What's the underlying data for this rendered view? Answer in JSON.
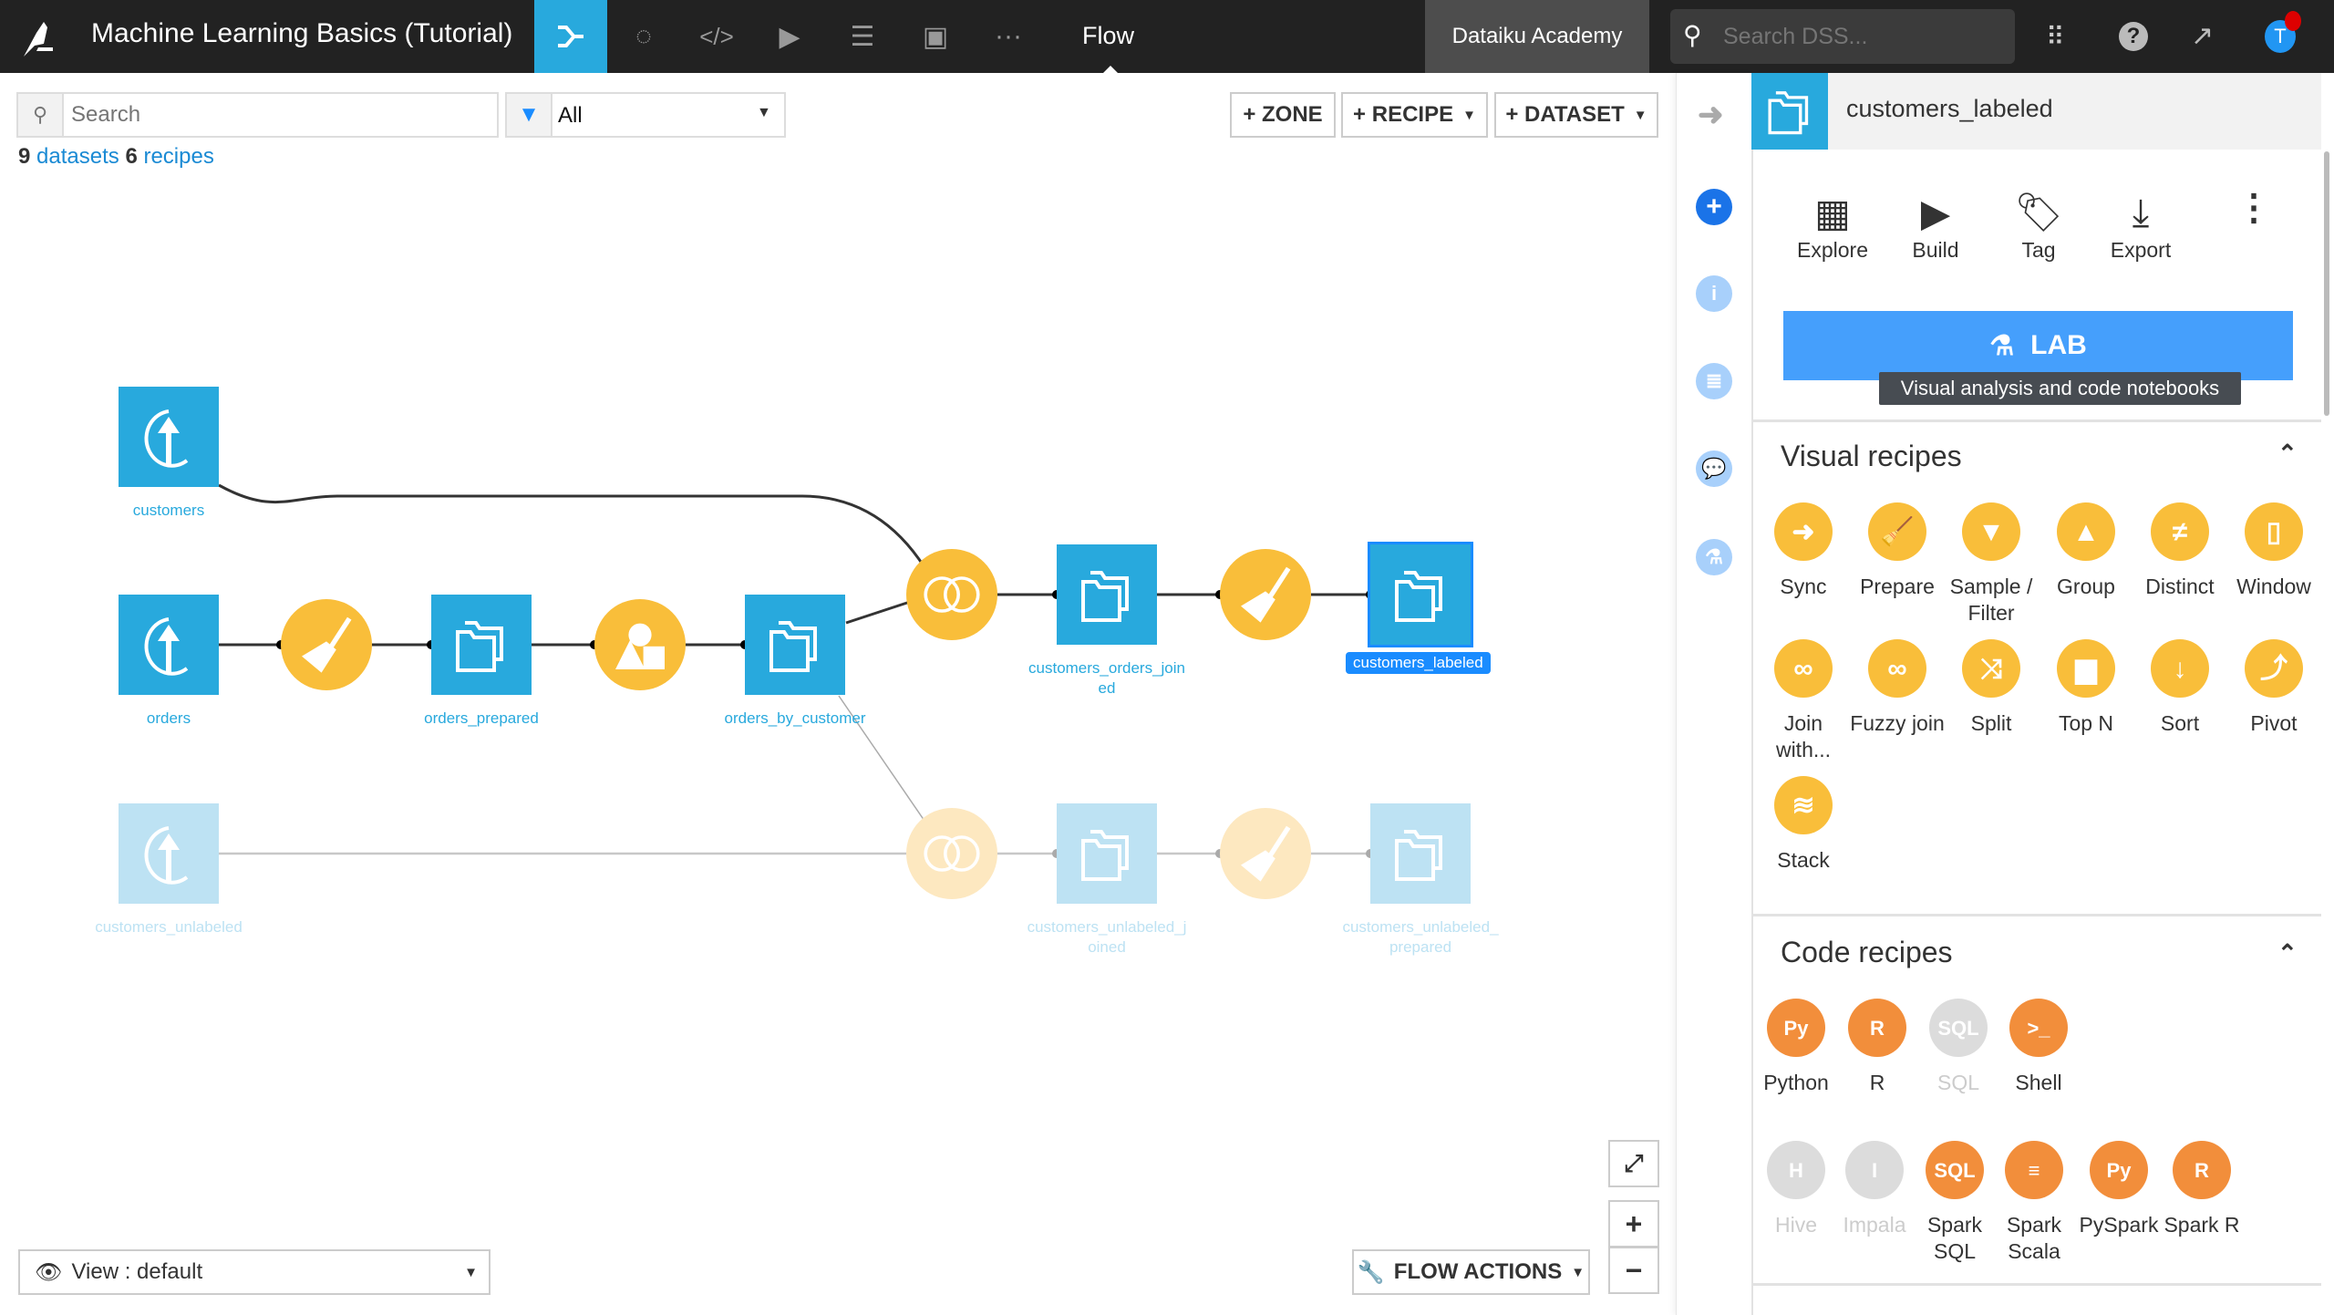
{
  "app": {
    "title": "Machine Learning Basics (Tutorial)",
    "current_view": "Flow",
    "instance": "Dataiku Academy",
    "search_placeholder": "Search DSS...",
    "avatar_initial": "T",
    "nav_icons": [
      "flow-icon",
      "recipes-icon",
      "code-icon",
      "jobs-icon",
      "datasets-icon",
      "dashboard-icon",
      "more-icon"
    ]
  },
  "flow_toolbar": {
    "search_placeholder": "Search",
    "filter_value": "All",
    "zone_btn": "+ ZONE",
    "recipe_btn": "+ RECIPE",
    "dataset_btn": "+ DATASET",
    "count_datasets": "9",
    "datasets_word": "datasets",
    "count_recipes": "6",
    "recipes_word": "recipes"
  },
  "flow": {
    "datasets": [
      {
        "label": "customers",
        "kind": "upload",
        "faded": false
      },
      {
        "label": "orders",
        "kind": "upload",
        "faded": false
      },
      {
        "label": "orders_prepared",
        "kind": "folder",
        "faded": false
      },
      {
        "label": "orders_by_customer",
        "kind": "folder",
        "faded": false
      },
      {
        "label": "customers_orders_joined",
        "kind": "folder",
        "faded": false
      },
      {
        "label": "customers_labeled",
        "kind": "folder",
        "faded": false,
        "selected": true
      },
      {
        "label": "customers_unlabeled",
        "kind": "upload",
        "faded": true
      },
      {
        "label": "customers_unlabeled_joined",
        "kind": "folder",
        "faded": true
      },
      {
        "label": "customers_unlabeled_prepared",
        "kind": "folder",
        "faded": true
      }
    ],
    "recipes": [
      {
        "type": "prepare",
        "faded": false
      },
      {
        "type": "group",
        "faded": false
      },
      {
        "type": "join",
        "faded": false
      },
      {
        "type": "prepare",
        "faded": false
      },
      {
        "type": "join",
        "faded": true
      },
      {
        "type": "prepare",
        "faded": true
      }
    ],
    "colors": {
      "dataset": "#28a9dd",
      "dataset_faded": "#bde2f3",
      "recipe": "#f9be3a",
      "recipe_faded": "#fde8c0",
      "selected": "#1a8cff"
    }
  },
  "bottom": {
    "view_label": "View : default",
    "flow_actions": "FLOW ACTIONS"
  },
  "panel": {
    "title": "customers_labeled",
    "tools": [
      {
        "label": "Explore",
        "icon": "table-icon"
      },
      {
        "label": "Build",
        "icon": "play-icon"
      },
      {
        "label": "Tag",
        "icon": "tag-icon"
      },
      {
        "label": "Export",
        "icon": "download-icon"
      }
    ],
    "lab_label": "LAB",
    "lab_tooltip": "Visual analysis and code notebooks",
    "visual_title": "Visual recipes",
    "visual_recipes": [
      {
        "label": "Sync",
        "glyph": "➜"
      },
      {
        "label": "Prepare",
        "glyph": "🧹"
      },
      {
        "label": "Sample / Filter",
        "glyph": "▼"
      },
      {
        "label": "Group",
        "glyph": "▲"
      },
      {
        "label": "Distinct",
        "glyph": "≠"
      },
      {
        "label": "Window",
        "glyph": "▯"
      },
      {
        "label": "Join with...",
        "glyph": "∞"
      },
      {
        "label": "Fuzzy join",
        "glyph": "∞"
      },
      {
        "label": "Split",
        "glyph": "⤨"
      },
      {
        "label": "Top N",
        "glyph": "▆"
      },
      {
        "label": "Sort",
        "glyph": "↓"
      },
      {
        "label": "Pivot",
        "glyph": "⤴"
      },
      {
        "label": "Stack",
        "glyph": "≋"
      }
    ],
    "code_title": "Code recipes",
    "code_recipes": [
      {
        "label": "Python",
        "glyph": "Py",
        "enabled": true
      },
      {
        "label": "R",
        "glyph": "R",
        "enabled": true
      },
      {
        "label": "SQL",
        "glyph": "SQL",
        "enabled": false
      },
      {
        "label": "Shell",
        "glyph": ">_",
        "enabled": true
      },
      {
        "label": "Hive",
        "glyph": "H",
        "enabled": false
      },
      {
        "label": "Impala",
        "glyph": "I",
        "enabled": false
      },
      {
        "label": "Spark SQL",
        "glyph": "SQL",
        "enabled": true
      },
      {
        "label": "Spark Scala",
        "glyph": "≡",
        "enabled": true
      },
      {
        "label": "PySpark",
        "glyph": "Py",
        "enabled": true
      },
      {
        "label": "Spark R",
        "glyph": "R",
        "enabled": true
      }
    ],
    "colors": {
      "visual": "#f9be3a",
      "code": "#f28e3b",
      "disabled": "#dcdcdc",
      "lab": "#459ffc"
    }
  }
}
